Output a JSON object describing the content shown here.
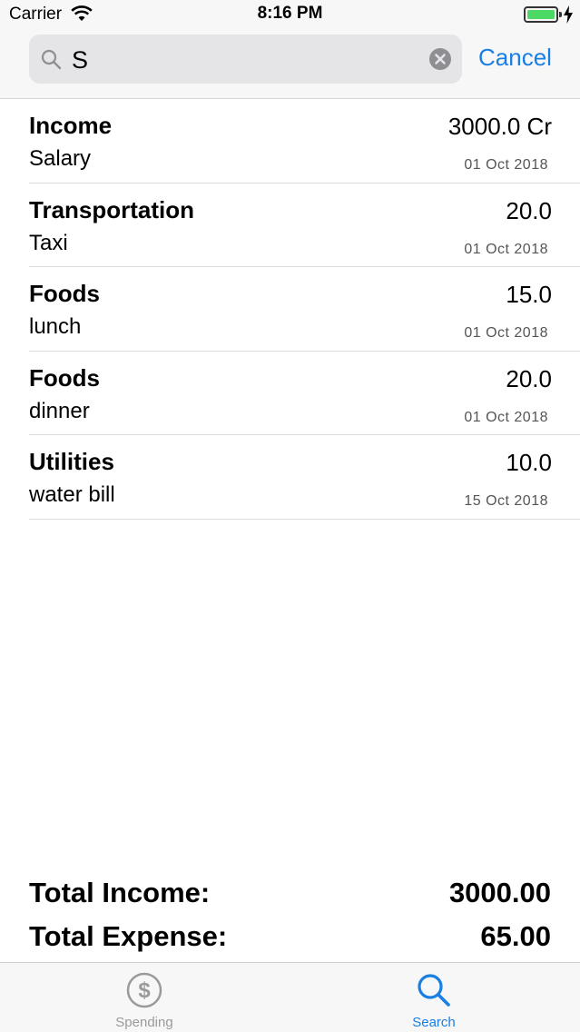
{
  "status_bar": {
    "carrier": "Carrier",
    "time": "8:16 PM",
    "battery_color": "#4cd964"
  },
  "search": {
    "value": "S",
    "cancel_label": "Cancel",
    "accent": "#1a7fe3"
  },
  "transactions": [
    {
      "category": "Income",
      "amount": "3000.0 Cr",
      "note": "Salary",
      "date": "01 Oct 2018"
    },
    {
      "category": "Transportation",
      "amount": "20.0",
      "note": "Taxi",
      "date": "01 Oct 2018"
    },
    {
      "category": "Foods",
      "amount": "15.0",
      "note": "lunch",
      "date": "01 Oct 2018"
    },
    {
      "category": "Foods",
      "amount": "20.0",
      "note": "dinner",
      "date": "01 Oct 2018"
    },
    {
      "category": "Utilities",
      "amount": "10.0",
      "note": "water bill",
      "date": "15 Oct 2018"
    }
  ],
  "totals": {
    "income_label": "Total Income:",
    "income_value": "3000.00",
    "expense_label": "Total Expense:",
    "expense_value": "65.00"
  },
  "tabs": [
    {
      "label": "Spending",
      "icon": "dollar-circle-icon",
      "active": false
    },
    {
      "label": "Search",
      "icon": "search-icon",
      "active": true
    }
  ]
}
